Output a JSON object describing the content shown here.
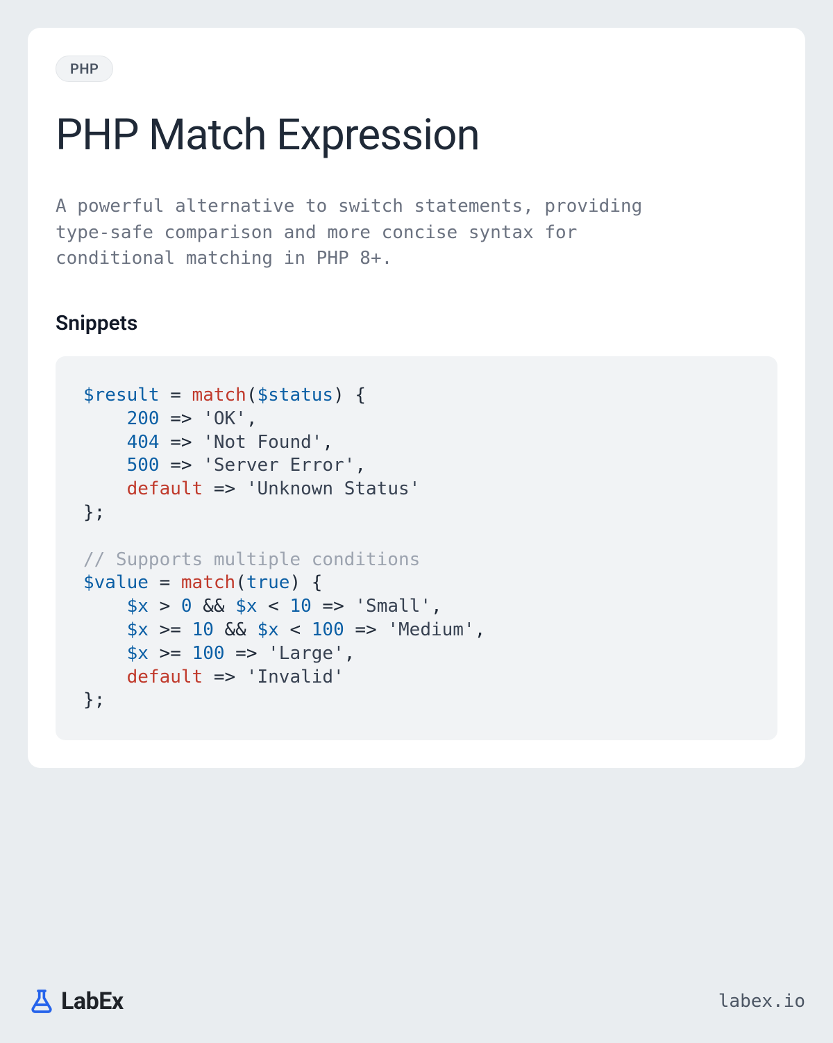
{
  "badge": "PHP",
  "title": "PHP Match Expression",
  "description": "A powerful alternative to switch statements, providing type-safe comparison and more concise syntax for conditional matching in PHP 8+.",
  "section_heading": "Snippets",
  "code": {
    "l1": {
      "var": "$result",
      "assign": " = ",
      "kw": "match",
      "open": "(",
      "arg": "$status",
      "close": ") {"
    },
    "l2": {
      "indent": "    ",
      "num": "200",
      "arrow": " => ",
      "str": "'OK'",
      "comma": ","
    },
    "l3": {
      "indent": "    ",
      "num": "404",
      "arrow": " => ",
      "str": "'Not Found'",
      "comma": ","
    },
    "l4": {
      "indent": "    ",
      "num": "500",
      "arrow": " => ",
      "str": "'Server Error'",
      "comma": ","
    },
    "l5": {
      "indent": "    ",
      "kw": "default",
      "arrow": " => ",
      "str": "'Unknown Status'"
    },
    "l6": {
      "text": "};"
    },
    "blank": " ",
    "l7": {
      "com": "// Supports multiple conditions"
    },
    "l8": {
      "var": "$value",
      "assign": " = ",
      "kw": "match",
      "open": "(",
      "bool": "true",
      "close": ") {"
    },
    "l9": {
      "indent": "    ",
      "v1": "$x",
      "op1": " > ",
      "n1": "0",
      "and": " && ",
      "v2": "$x",
      "op2": " < ",
      "n2": "10",
      "arrow": " => ",
      "str": "'Small'",
      "comma": ","
    },
    "l10": {
      "indent": "    ",
      "v1": "$x",
      "op1": " >= ",
      "n1": "10",
      "and": " && ",
      "v2": "$x",
      "op2": " < ",
      "n2": "100",
      "arrow": " => ",
      "str": "'Medium'",
      "comma": ","
    },
    "l11": {
      "indent": "    ",
      "v1": "$x",
      "op1": " >= ",
      "n1": "100",
      "arrow": " => ",
      "str": "'Large'",
      "comma": ","
    },
    "l12": {
      "indent": "    ",
      "kw": "default",
      "arrow": " => ",
      "str": "'Invalid'"
    },
    "l13": {
      "text": "};"
    }
  },
  "brand": "LabEx",
  "site": "labex.io"
}
